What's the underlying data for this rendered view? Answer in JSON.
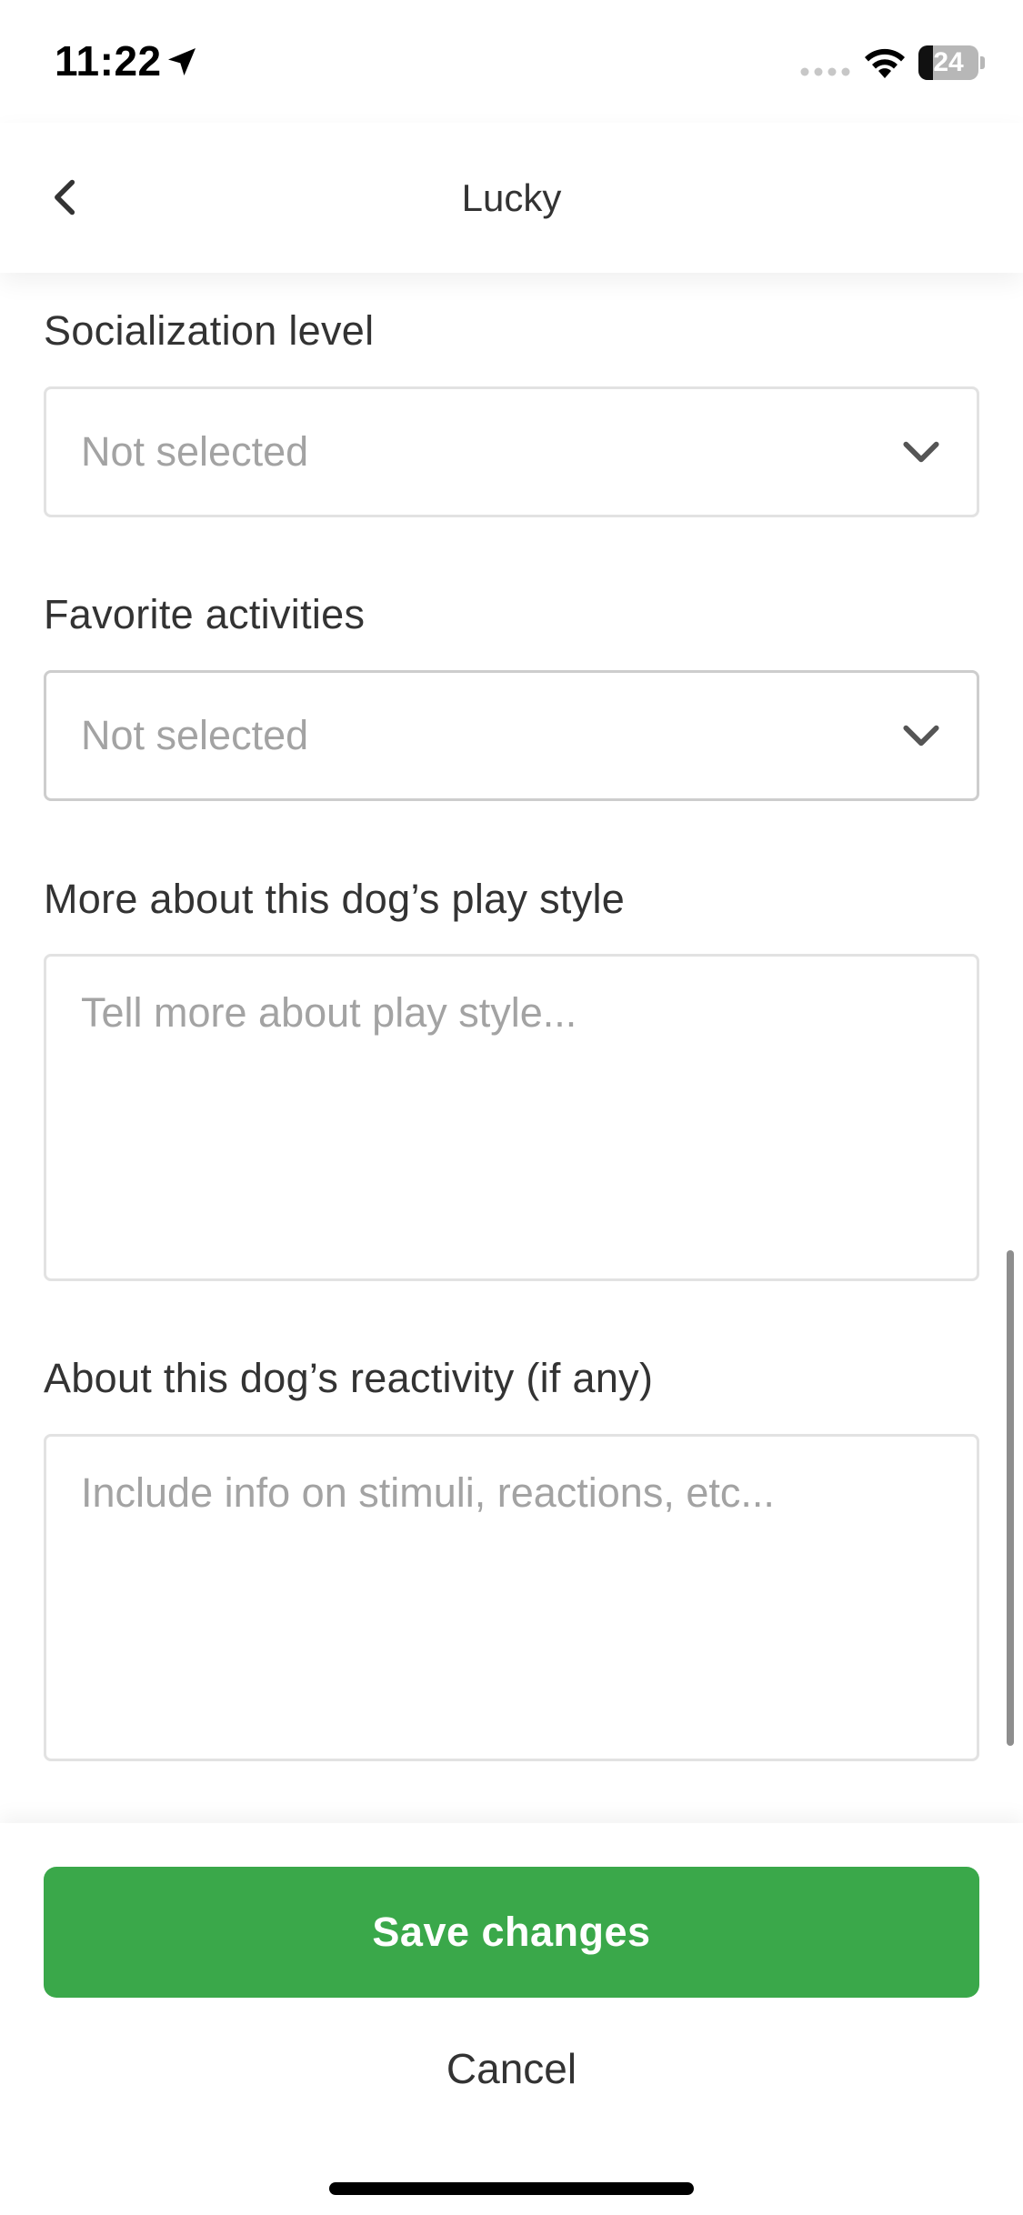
{
  "status_bar": {
    "time": "11:22",
    "battery_level": "24",
    "icons": [
      "location-arrow-icon",
      "cellular-signal-icon",
      "wifi-icon",
      "battery-icon"
    ]
  },
  "header": {
    "title": "Lucky",
    "back_icon": "chevron-left-icon"
  },
  "form": {
    "socialization": {
      "label": "Socialization level",
      "value": "Not selected",
      "icon": "chevron-down-icon"
    },
    "activities": {
      "label": "Favorite activities",
      "value": "Not selected",
      "icon": "chevron-down-icon"
    },
    "play_style": {
      "label": "More about this dog’s play style",
      "placeholder": "Tell more about play style..."
    },
    "reactivity": {
      "label": "About this dog’s reactivity (if any)",
      "placeholder": "Include info on stimuli, reactions, etc..."
    }
  },
  "footer": {
    "save_label": "Save changes",
    "cancel_label": "Cancel"
  },
  "colors": {
    "accent_green": "#3aa84a",
    "placeholder_gray": "#a3a3a3",
    "text_dark": "#333333",
    "border": "#e2e2e2"
  }
}
